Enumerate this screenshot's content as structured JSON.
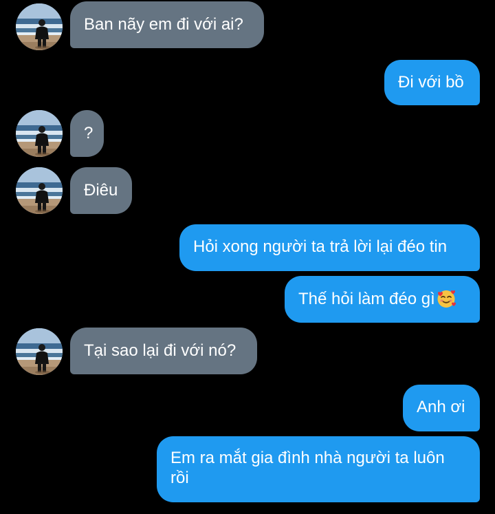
{
  "conversation": {
    "messages": [
      {
        "side": "incoming",
        "text": "Ban nãy em đi với ai?"
      },
      {
        "side": "outgoing",
        "text": "Đi với bồ"
      },
      {
        "side": "incoming",
        "text": "?"
      },
      {
        "side": "incoming",
        "text": "Điêu"
      },
      {
        "side": "outgoing",
        "text": "Hỏi xong người ta trả lời lại đéo tin"
      },
      {
        "side": "outgoing",
        "text": "Thế hỏi làm đéo gì",
        "emoji": "smiling-face-with-hearts"
      },
      {
        "side": "incoming",
        "text": "Tại sao lại đi với nó?"
      },
      {
        "side": "outgoing",
        "text": "Anh ơi"
      },
      {
        "side": "outgoing",
        "text": "Em ra mắt gia đình nhà người ta luôn rồi"
      }
    ]
  },
  "colors": {
    "background": "#000000",
    "incoming_bubble": "#657482",
    "outgoing_bubble": "#1f9af0",
    "text": "#ffffff"
  },
  "icons": {
    "contact_avatar": "beach-photo-avatar",
    "reaction_emoji": "smiling-face-with-hearts"
  }
}
